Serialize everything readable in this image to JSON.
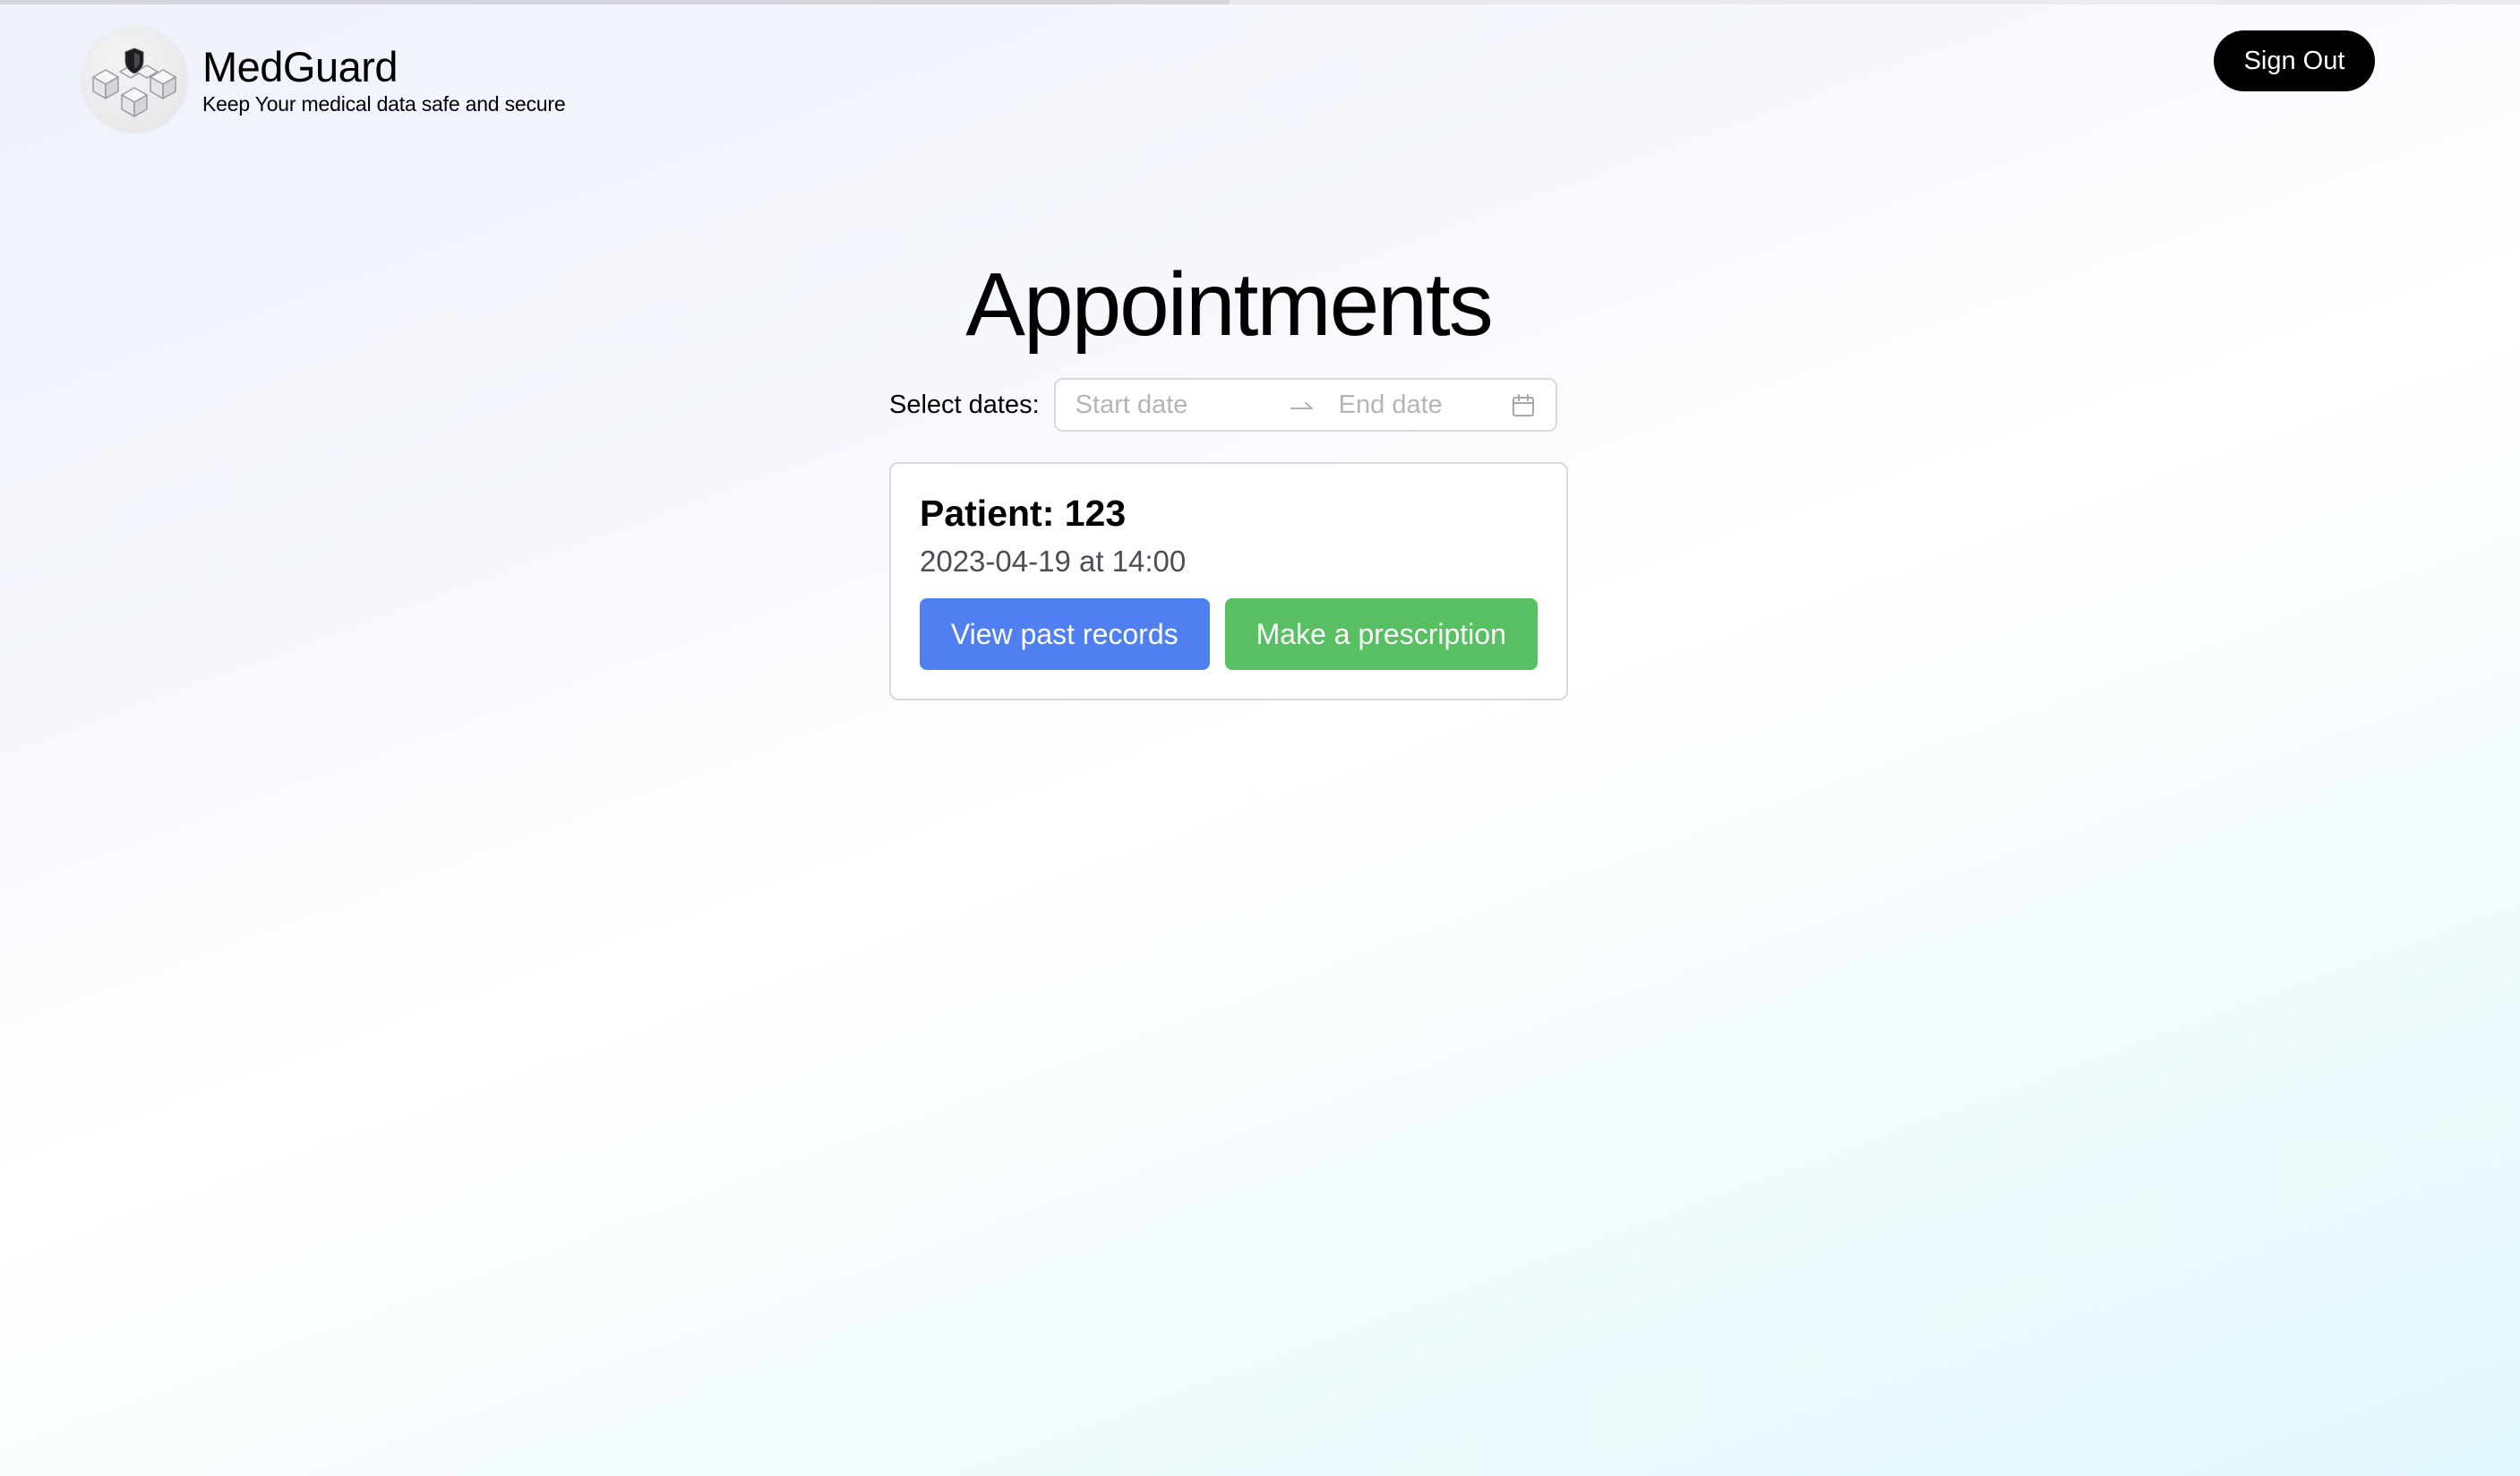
{
  "header": {
    "app_name": "MedGuard",
    "tagline": "Keep Your medical data safe and secure",
    "logo_icon": "shield-cubes-logo",
    "sign_out_label": "Sign Out"
  },
  "main": {
    "title": "Appointments",
    "date_filter": {
      "label": "Select dates",
      "label_suffix": ":",
      "start_placeholder": "Start date",
      "end_placeholder": "End date",
      "separator_icon": "arrow-right-icon",
      "calendar_icon": "calendar-icon"
    },
    "appointments": [
      {
        "patient_title": "Patient: 123",
        "datetime": "2023-04-19 at 14:00",
        "view_records_label": "View past records",
        "prescription_label": "Make a prescription"
      }
    ]
  },
  "colors": {
    "primary_button": "#4f7ff0",
    "success_button": "#58c063",
    "sign_out_bg": "#000000"
  }
}
